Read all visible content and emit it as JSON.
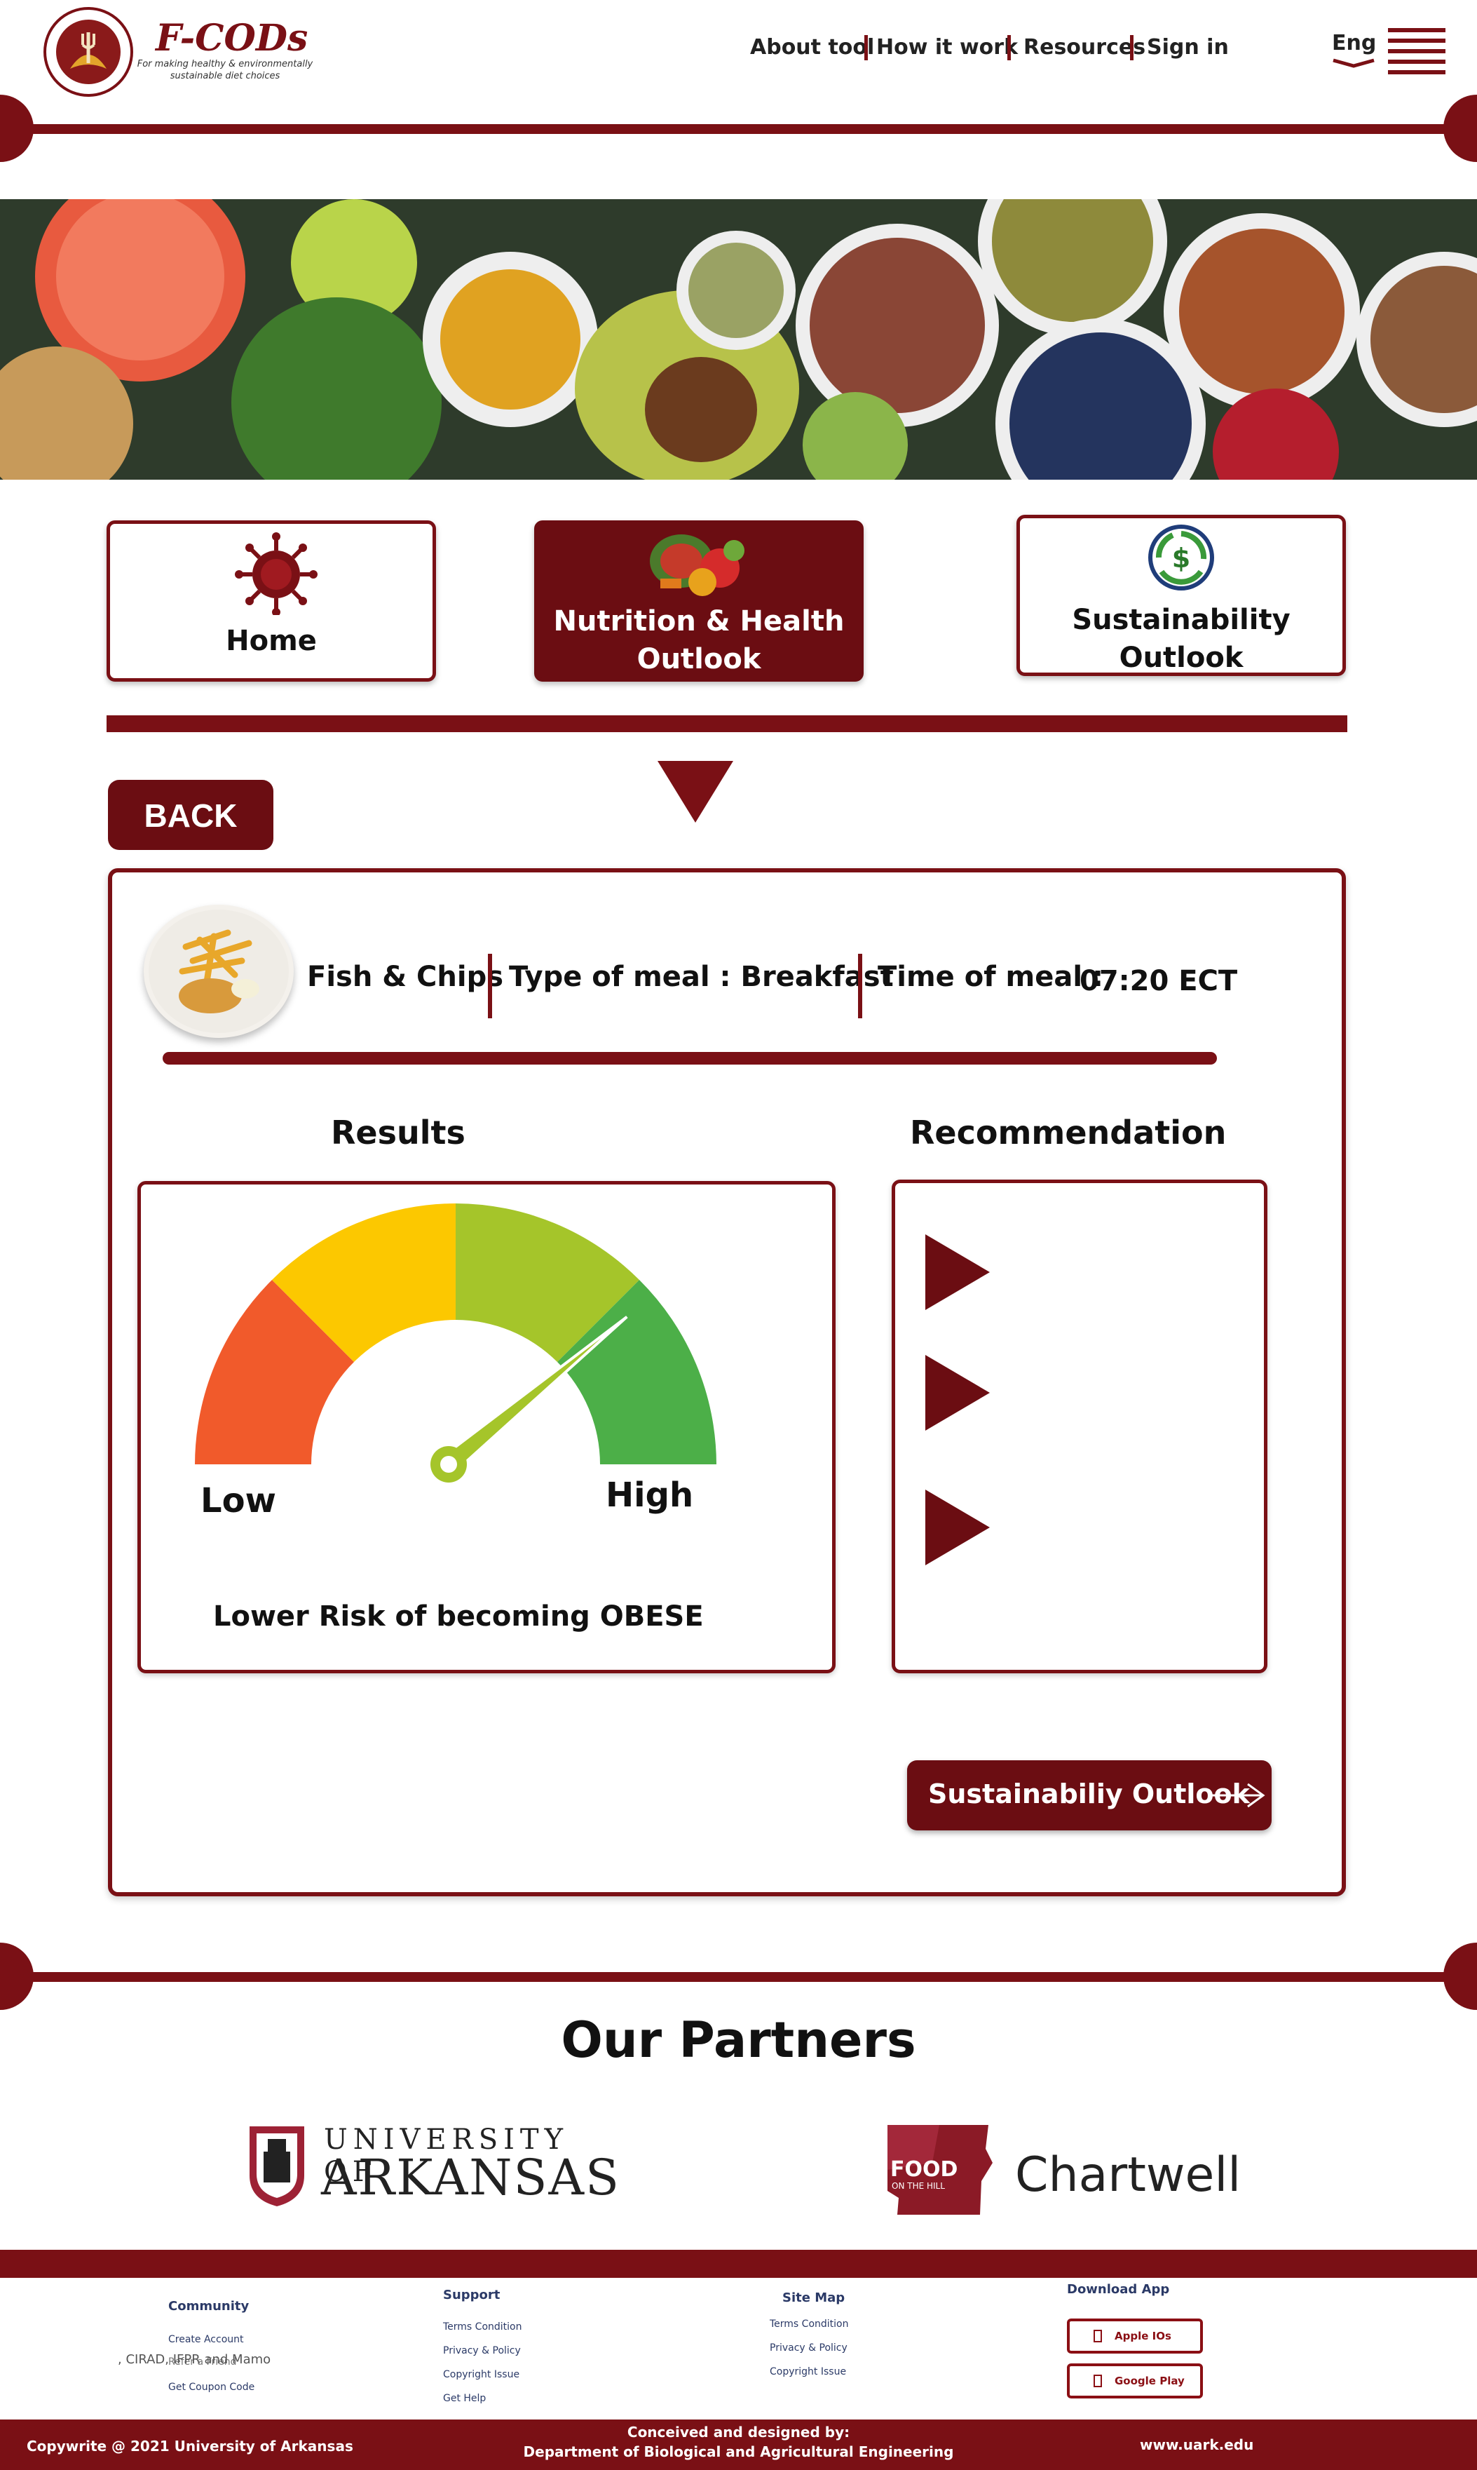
{
  "header": {
    "brand": "F-CODs",
    "tagline": "For making healthy & environmentally sustainable diet choices",
    "nav": [
      "About tool",
      "How it work",
      "Resources",
      "Sign in"
    ],
    "language": "Eng"
  },
  "tabs": [
    {
      "label": "Home"
    },
    {
      "label": "Nutrition & Health Outlook"
    },
    {
      "label": "Sustainability Outlook"
    }
  ],
  "back_label": "BACK",
  "meal": {
    "name": "Fish & Chips",
    "type_label": "Type of meal : Breakfast",
    "time_label": "Time of meal :",
    "time_value": "07:20 ECT"
  },
  "results": {
    "title": "Results",
    "low_label": "Low",
    "high_label": "High",
    "risk_text": "Lower Risk of becoming OBESE",
    "gauge_level": 0.78
  },
  "recommendation": {
    "title": "Recommendation",
    "items": [
      "",
      "",
      ""
    ]
  },
  "sustainability_button": "Sustainabiliy Outlook",
  "partners": {
    "title": "Our Partners",
    "uark_line1": "UNIVERSITY OF",
    "uark_line2": "ARKANSAS",
    "foodhill": "FOOD",
    "foodhill_sub": "ON THE HILL",
    "chartwell": "Chartwell"
  },
  "footer": {
    "community": {
      "title": "Community",
      "links": [
        "Create Account",
        "Refer a Friend",
        "Get Coupon Code"
      ]
    },
    "community_overlay": ", CIRAD, IFPR and Mamo",
    "support": {
      "title": "Support",
      "links": [
        "Terms Condition",
        "Privacy & Policy",
        "Copyright Issue",
        "Get Help"
      ]
    },
    "sitemap": {
      "title": "Site Map",
      "links": [
        "Terms Condition",
        "Privacy & Policy",
        "Copyright Issue"
      ]
    },
    "download": {
      "title": "Download App",
      "apple": "Apple IOs",
      "google": "Google Play"
    },
    "copyright": "Copywrite @ 2021 University of Arkansas",
    "credit_line1": "Conceived and designed by:",
    "credit_line2": "Department of Biological and Agricultural Engineering",
    "website": "www.uark.edu"
  },
  "colors": {
    "brand": "#7a1015",
    "button": "#6b0d12"
  },
  "icons": [
    "logo-icon",
    "menu-icon",
    "virus-icon",
    "vegetables-icon",
    "recycle-dollar-icon",
    "arrow-right-icon"
  ]
}
